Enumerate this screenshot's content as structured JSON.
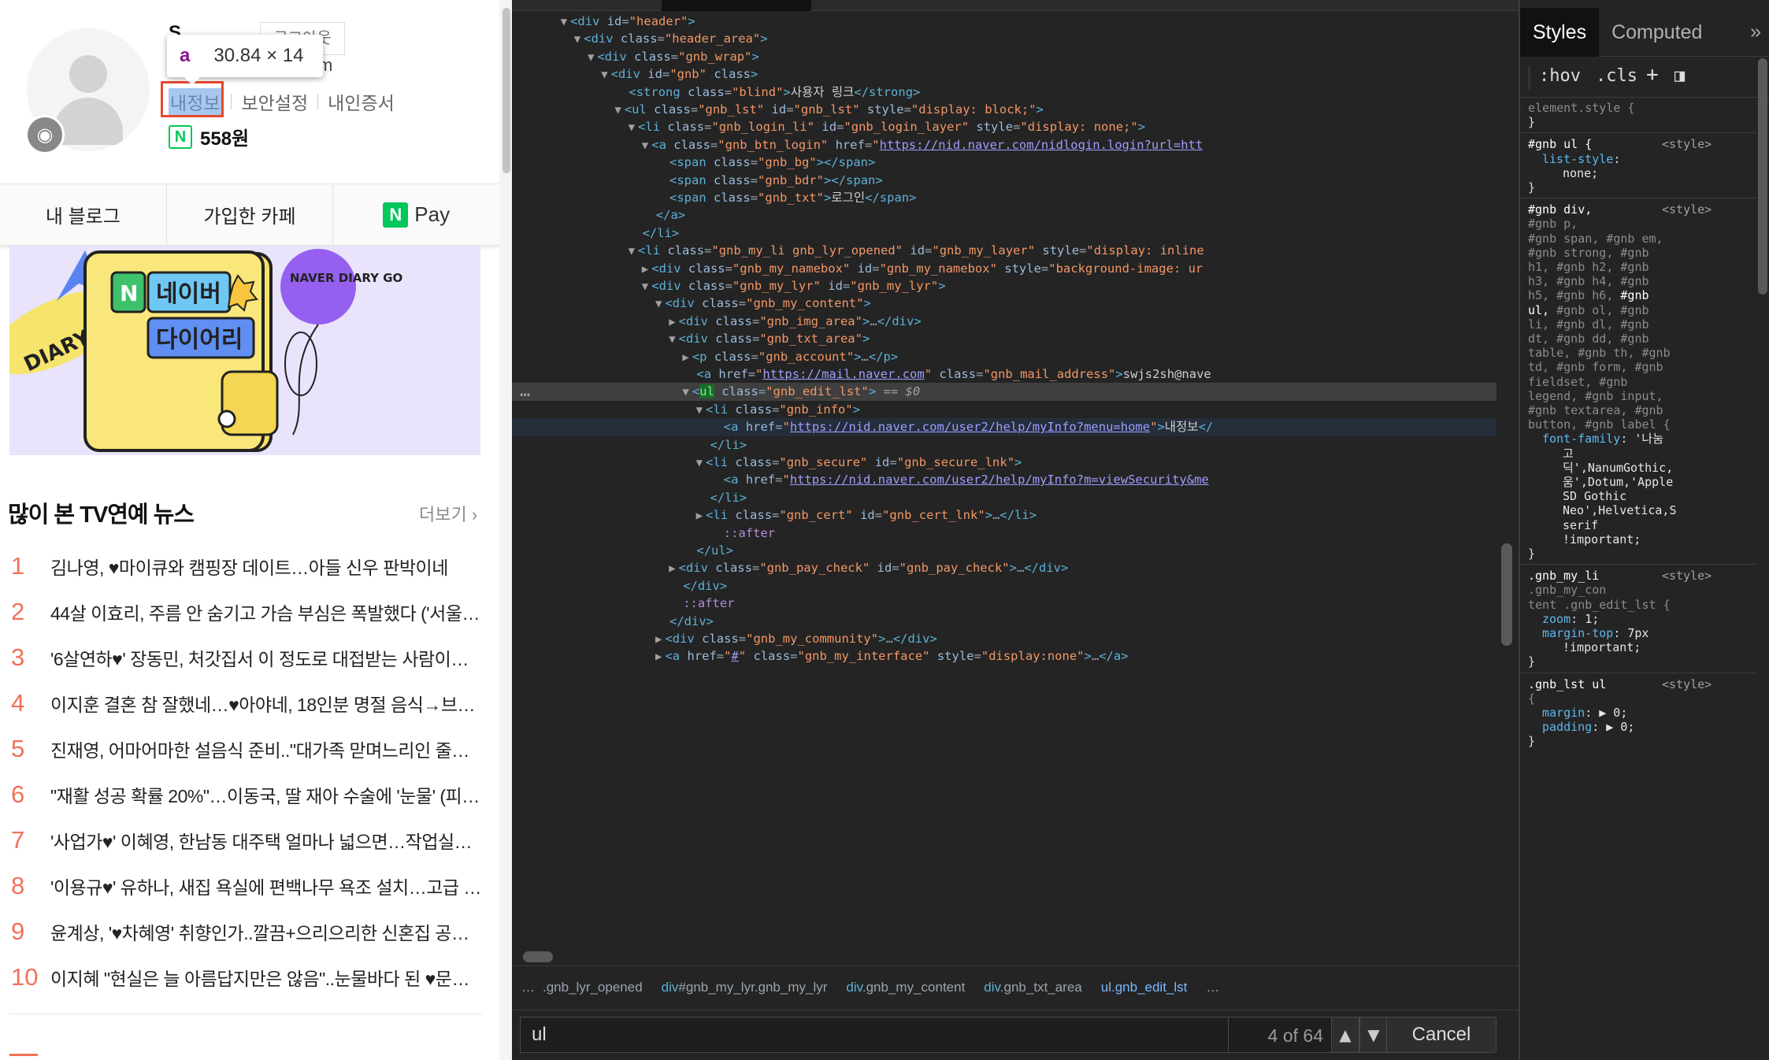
{
  "left_page": {
    "tooltip": {
      "tag": "a",
      "dims": "30.84 × 14"
    },
    "profile": {
      "name_fragment": "S",
      "logout_label": "로그아웃",
      "email_tail": "m",
      "links": [
        "내정보",
        "보안설정",
        "내인증서"
      ],
      "points": "558원",
      "points_badge": "N"
    },
    "tabs": [
      "내 블로그",
      "가입한 카페",
      "Pay"
    ],
    "banner": {
      "n_badge": "N",
      "line1": "네이버",
      "line2": "다이어리",
      "ribbon": "DIARY",
      "circle": "NAVER DIARY GO"
    },
    "news": {
      "title": "많이 본 TV연예 뉴스",
      "more": "더보기",
      "items": [
        {
          "num": "1",
          "text": "김나영, ♥마이큐와 캠핑장 데이트…아들 신우 판박이네"
        },
        {
          "num": "2",
          "text": "44살 이효리, 주름 안 숨기고 가슴 부심은 폭발했다 ('서울…"
        },
        {
          "num": "3",
          "text": "'6살연하♥' 장동민, 처갓집서 이 정도로 대접받는 사람이…"
        },
        {
          "num": "4",
          "text": "이지훈 결혼 참 잘했네…♥아야네, 18인분 명절 음식→브…"
        },
        {
          "num": "5",
          "text": "진재영, 어마어마한 설음식 준비..\"대가족 맏며느리인 줄…"
        },
        {
          "num": "6",
          "text": "\"재활 성공 확률 20%\"…이동국, 딸 재아 수술에 '눈물' (피…"
        },
        {
          "num": "7",
          "text": "'사업가♥' 이혜영, 한남동 대주택 얼마나 넓으면…작업실…"
        },
        {
          "num": "8",
          "text": "'이용규♥' 유하나, 새집 욕실에 편백나무 욕조 설치…고급 …"
        },
        {
          "num": "9",
          "text": "윤계상, '♥차혜영' 취향인가..깔끔+으리으리한 신혼집 공…"
        },
        {
          "num": "10",
          "text": "이지혜 \"현실은 늘 아름답지만은 않음\"..눈물바다 된 ♥문…"
        }
      ]
    }
  },
  "devtools": {
    "dom_lines": [
      {
        "indent": 3,
        "tri": "▼",
        "html": "<span class='tagc'>&lt;div</span> <span class='attr'>id</span>=<span class='aval'>\"header\"</span><span class='tagc'>&gt;</span>"
      },
      {
        "indent": 4,
        "tri": "▼",
        "html": "<span class='tagc'>&lt;div</span> <span class='attr'>class</span>=<span class='aval'>\"header_area\"</span><span class='tagc'>&gt;</span>"
      },
      {
        "indent": 5,
        "tri": "▼",
        "html": "<span class='tagc'>&lt;div</span> <span class='attr'>class</span>=<span class='aval'>\"gnb_wrap\"</span><span class='tagc'>&gt;</span>"
      },
      {
        "indent": 6,
        "tri": "▼",
        "html": "<span class='tagc'>&lt;div</span> <span class='attr'>id</span>=<span class='aval'>\"gnb\"</span> <span class='attr'>class</span><span class='tagc'>&gt;</span>"
      },
      {
        "indent": 7,
        "tri": "",
        "html": "<span class='tagc'>&lt;strong</span> <span class='attr'>class</span>=<span class='aval'>\"blind\"</span><span class='tagc'>&gt;</span><span class='txtc'>사용자 링크</span><span class='tagc'>&lt;/strong&gt;</span>"
      },
      {
        "indent": 7,
        "tri": "▼",
        "html": "<span class='tagc'>&lt;ul</span> <span class='attr'>class</span>=<span class='aval'>\"gnb_lst\"</span> <span class='attr'>id</span>=<span class='aval'>\"gnb_lst\"</span> <span class='attr'>style</span>=<span class='aval'>\"display: block;\"</span><span class='tagc'>&gt;</span>"
      },
      {
        "indent": 8,
        "tri": "▼",
        "html": "<span class='tagc'>&lt;li</span> <span class='attr'>class</span>=<span class='aval'>\"gnb_login_li\"</span> <span class='attr'>id</span>=<span class='aval'>\"gnb_login_layer\"</span> <span class='attr'>style</span>=<span class='aval'>\"display: none;\"</span><span class='tagc'>&gt;</span>"
      },
      {
        "indent": 9,
        "tri": "▼",
        "html": "<span class='tagc'>&lt;a</span> <span class='attr'>class</span>=<span class='aval'>\"gnb_btn_login\"</span> <span class='attr'>href</span>=<span class='aval'>\"</span><span class='url'>https://nid.naver.com/nidlogin.login?url=htt</span>"
      },
      {
        "indent": 10,
        "tri": "",
        "html": "<span class='tagc'>&lt;span</span> <span class='attr'>class</span>=<span class='aval'>\"gnb_bg\"</span><span class='tagc'>&gt;&lt;/span&gt;</span>"
      },
      {
        "indent": 10,
        "tri": "",
        "html": "<span class='tagc'>&lt;span</span> <span class='attr'>class</span>=<span class='aval'>\"gnb_bdr\"</span><span class='tagc'>&gt;&lt;/span&gt;</span>"
      },
      {
        "indent": 10,
        "tri": "",
        "html": "<span class='tagc'>&lt;span</span> <span class='attr'>class</span>=<span class='aval'>\"gnb_txt\"</span><span class='tagc'>&gt;</span><span class='txtc'>로그인</span><span class='tagc'>&lt;/span&gt;</span>"
      },
      {
        "indent": 9,
        "tri": "",
        "html": "<span class='tagc'>&lt;/a&gt;</span>"
      },
      {
        "indent": 8,
        "tri": "",
        "html": "<span class='tagc'>&lt;/li&gt;</span>"
      },
      {
        "indent": 8,
        "tri": "▼",
        "html": "<span class='tagc'>&lt;li</span> <span class='attr'>class</span>=<span class='aval'>\"gnb_my_li gnb_lyr_opened\"</span> <span class='attr'>id</span>=<span class='aval'>\"gnb_my_layer\"</span> <span class='attr'>style</span>=<span class='aval'>\"display: inline</span>"
      },
      {
        "indent": 9,
        "tri": "▶",
        "html": "<span class='tagc'>&lt;div</span> <span class='attr'>class</span>=<span class='aval'>\"gnb_my_namebox\"</span> <span class='attr'>id</span>=<span class='aval'>\"gnb_my_namebox\"</span> <span class='attr'>style</span>=<span class='aval'>\"background-image: ur</span>"
      },
      {
        "indent": 9,
        "tri": "▼",
        "html": "<span class='tagc'>&lt;div</span> <span class='attr'>class</span>=<span class='aval'>\"gnb_my_lyr\"</span> <span class='attr'>id</span>=<span class='aval'>\"gnb_my_lyr\"</span><span class='tagc'>&gt;</span>"
      },
      {
        "indent": 10,
        "tri": "▼",
        "html": "<span class='tagc'>&lt;div</span> <span class='attr'>class</span>=<span class='aval'>\"gnb_my_content\"</span><span class='tagc'>&gt;</span>"
      },
      {
        "indent": 11,
        "tri": "▶",
        "html": "<span class='tagc'>&lt;div</span> <span class='attr'>class</span>=<span class='aval'>\"gnb_img_area\"</span><span class='tagc'>&gt;</span>…<span class='tagc'>&lt;/div&gt;</span>"
      },
      {
        "indent": 11,
        "tri": "▼",
        "html": "<span class='tagc'>&lt;div</span> <span class='attr'>class</span>=<span class='aval'>\"gnb_txt_area\"</span><span class='tagc'>&gt;</span>"
      },
      {
        "indent": 12,
        "tri": "▶",
        "html": "<span class='tagc'>&lt;p</span> <span class='attr'>class</span>=<span class='aval'>\"gnb_account\"</span><span class='tagc'>&gt;</span>…<span class='tagc'>&lt;/p&gt;</span>"
      },
      {
        "indent": 12,
        "tri": "",
        "html": "<span class='tagc'>&lt;a</span> <span class='attr'>href</span>=<span class='aval'>\"</span><span class='url'>https://mail.naver.com</span><span class='aval'>\"</span> <span class='attr'>class</span>=<span class='aval'>\"gnb_mail_address\"</span><span class='tagc'>&gt;</span><span class='txtc'>swjs2sh@nave</span>"
      },
      {
        "indent": 12,
        "tri": "▼",
        "sel": true,
        "html": "<span class='tagc'>&lt;</span><span class='ulhl'>ul</span> <span class='attr'>class</span>=<span class='aval'>\"gnb_edit_lst\"</span><span class='tagc'>&gt;</span> <span class='eqs'>== $0</span>"
      },
      {
        "indent": 13,
        "tri": "▼",
        "html": "<span class='tagc'>&lt;li</span> <span class='attr'>class</span>=<span class='aval'>\"gnb_info\"</span><span class='tagc'>&gt;</span>"
      },
      {
        "indent": 14,
        "tri": "",
        "hover": true,
        "html": "<span class='tagc'>&lt;a</span> <span class='attr'>href</span>=<span class='aval'>\"</span><span class='url'>https://nid.naver.com/user2/help/myInfo?menu=home</span><span class='aval'>\"</span><span class='tagc'>&gt;</span><span class='txtc'>내정보</span><span class='tagc'>&lt;/</span>"
      },
      {
        "indent": 13,
        "tri": "",
        "html": "<span class='tagc'>&lt;/li&gt;</span>"
      },
      {
        "indent": 13,
        "tri": "▼",
        "html": "<span class='tagc'>&lt;li</span> <span class='attr'>class</span>=<span class='aval'>\"gnb_secure\"</span> <span class='attr'>id</span>=<span class='aval'>\"gnb_secure_lnk\"</span><span class='tagc'>&gt;</span>"
      },
      {
        "indent": 14,
        "tri": "",
        "html": "<span class='tagc'>&lt;a</span> <span class='attr'>href</span>=<span class='aval'>\"</span><span class='url'>https://nid.naver.com/user2/help/myInfo?m=viewSecurity&amp;me</span>"
      },
      {
        "indent": 13,
        "tri": "",
        "html": "<span class='tagc'>&lt;/li&gt;</span>"
      },
      {
        "indent": 13,
        "tri": "▶",
        "html": "<span class='tagc'>&lt;li</span> <span class='attr'>class</span>=<span class='aval'>\"gnb_cert\"</span> <span class='attr'>id</span>=<span class='aval'>\"gnb_cert_lnk\"</span><span class='tagc'>&gt;</span>…<span class='tagc'>&lt;/li&gt;</span>"
      },
      {
        "indent": 14,
        "tri": "",
        "html": "<span class='pseudo'>::after</span>"
      },
      {
        "indent": 12,
        "tri": "",
        "html": "<span class='tagc'>&lt;/ul&gt;</span>"
      },
      {
        "indent": 11,
        "tri": "▶",
        "html": "<span class='tagc'>&lt;div</span> <span class='attr'>class</span>=<span class='aval'>\"gnb_pay_check\"</span> <span class='attr'>id</span>=<span class='aval'>\"gnb_pay_check\"</span><span class='tagc'>&gt;</span>…<span class='tagc'>&lt;/div&gt;</span>"
      },
      {
        "indent": 11,
        "tri": "",
        "html": "<span class='tagc'>&lt;/div&gt;</span>"
      },
      {
        "indent": 11,
        "tri": "",
        "html": "<span class='pseudo'>::after</span>"
      },
      {
        "indent": 10,
        "tri": "",
        "html": "<span class='tagc'>&lt;/div&gt;</span>"
      },
      {
        "indent": 10,
        "tri": "▶",
        "html": "<span class='tagc'>&lt;div</span> <span class='attr'>class</span>=<span class='aval'>\"gnb_my_community\"</span><span class='tagc'>&gt;</span>…<span class='tagc'>&lt;/div&gt;</span>"
      },
      {
        "indent": 10,
        "tri": "▶",
        "html": "<span class='tagc'>&lt;a</span> <span class='attr'>href</span>=<span class='aval'>\"</span><span class='url'>#</span><span class='aval'>\"</span> <span class='attr'>class</span>=<span class='aval'>\"gnb_my_interface\"</span> <span class='attr'>style</span>=<span class='aval'>\"display:none\"</span><span class='tagc'>&gt;</span>…<span class='tagc'>&lt;/a&gt;</span>"
      }
    ],
    "dots_label": "…",
    "breadcrumbs": [
      {
        "cls": ".gnb_lyr_opened",
        "tag": "",
        "current": false
      },
      {
        "cls": "#gnb_my_lyr.gnb_my_lyr",
        "tag": "div",
        "current": false
      },
      {
        "cls": ".gnb_my_content",
        "tag": "div",
        "current": false
      },
      {
        "cls": ".gnb_txt_area",
        "tag": "div",
        "current": false
      },
      {
        "cls": ".gnb_edit_lst",
        "tag": "ul",
        "current": true
      }
    ],
    "breadcrumb_ellipsis_left": "…",
    "breadcrumb_ellipsis_right": "…",
    "search": {
      "value": "ul",
      "count": "4 of 64",
      "prev_icon": "▲",
      "next_icon": "▼",
      "cancel": "Cancel"
    }
  },
  "styles_pane": {
    "tabs": [
      "Styles",
      "Computed"
    ],
    "more": "»",
    "filter": {
      "hov": ":hov",
      "cls": ".cls",
      "plus": "+",
      "toggle": "◨"
    },
    "rules": [
      {
        "t": "sel",
        "text": "element.style {"
      },
      {
        "t": "plain",
        "text": "}"
      },
      {
        "t": "sep"
      },
      {
        "t": "selsrc",
        "text": "#gnb ul {",
        "src": "<style>"
      },
      {
        "t": "prop",
        "name": "list-style",
        "value": ""
      },
      {
        "t": "cont",
        "text": "none;"
      },
      {
        "t": "plain",
        "text": "}"
      },
      {
        "t": "sep"
      },
      {
        "t": "selsrc",
        "text": "#gnb div,",
        "src": "<style>"
      },
      {
        "t": "sel",
        "text": "#gnb p,"
      },
      {
        "t": "sel",
        "text": "#gnb span, #gnb em,"
      },
      {
        "t": "sel",
        "text": "#gnb strong, #gnb"
      },
      {
        "t": "sel",
        "text": "h1, #gnb h2, #gnb"
      },
      {
        "t": "sel",
        "text": "h3, #gnb h4, #gnb"
      },
      {
        "t": "selhl",
        "text": "h5, #gnb h6, ",
        "hl": "#gnb"
      },
      {
        "t": "selhl2",
        "hl": "ul,",
        "text": " #gnb ol, #gnb"
      },
      {
        "t": "sel",
        "text": "li, #gnb dl, #gnb"
      },
      {
        "t": "sel",
        "text": "dt, #gnb dd, #gnb"
      },
      {
        "t": "sel",
        "text": "table, #gnb th, #gnb"
      },
      {
        "t": "sel",
        "text": "td, #gnb form, #gnb"
      },
      {
        "t": "sel",
        "text": "fieldset, #gnb"
      },
      {
        "t": "sel",
        "text": "legend, #gnb input,"
      },
      {
        "t": "sel",
        "text": "#gnb textarea, #gnb"
      },
      {
        "t": "sel",
        "text": "button, #gnb label {"
      },
      {
        "t": "prop",
        "name": "font-family",
        "value": "'나눔"
      },
      {
        "t": "cont",
        "text": "고"
      },
      {
        "t": "cont",
        "text": "딕',NanumGothic,"
      },
      {
        "t": "cont",
        "text": "움',Dotum,'Apple"
      },
      {
        "t": "cont",
        "text": "SD Gothic"
      },
      {
        "t": "cont",
        "text": "Neo',Helvetica,S"
      },
      {
        "t": "cont",
        "text": "serif"
      },
      {
        "t": "cont",
        "text": "!important;"
      },
      {
        "t": "plain",
        "text": "}"
      },
      {
        "t": "sep"
      },
      {
        "t": "selsrc",
        "text": ".gnb_my_li",
        "src": "<style>"
      },
      {
        "t": "sel",
        "text": ".gnb_my_con"
      },
      {
        "t": "sel",
        "text": "tent .gnb_edit_lst {"
      },
      {
        "t": "prop",
        "name": "zoom",
        "value": "1;"
      },
      {
        "t": "prop",
        "name": "margin-top",
        "value": "7px"
      },
      {
        "t": "cont",
        "text": "!important;"
      },
      {
        "t": "plain",
        "text": "}"
      },
      {
        "t": "sep"
      },
      {
        "t": "selsrc",
        "text": ".gnb_lst ul",
        "src": "<style>"
      },
      {
        "t": "sel",
        "text": "{"
      },
      {
        "t": "prop",
        "name": "margin",
        "value": "▶ 0;"
      },
      {
        "t": "prop",
        "name": "padding",
        "value": "▶ 0;"
      },
      {
        "t": "plain",
        "text": "}"
      }
    ]
  }
}
